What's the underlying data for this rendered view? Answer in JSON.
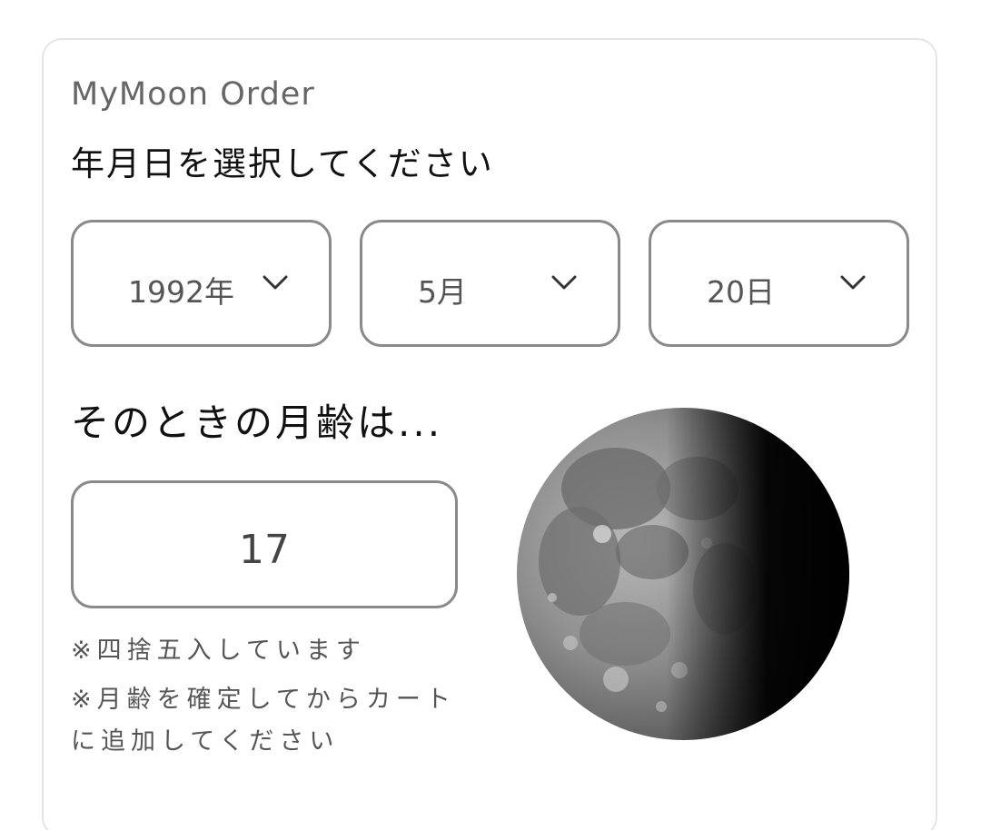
{
  "brand": "MyMoon Order",
  "prompt": "年月日を選択してください",
  "selectors": {
    "year": {
      "value": "1992年",
      "icon": "chevron-down-icon"
    },
    "month": {
      "value": "5月",
      "icon": "chevron-down-icon"
    },
    "day": {
      "value": "20日",
      "icon": "chevron-down-icon"
    }
  },
  "result": {
    "heading": "そのときの月齢は...",
    "moon_age": "17"
  },
  "notes": {
    "rounding": "※四捨五入しています",
    "add_to_cart": "※月齢を確定してからカートに追加してください"
  },
  "colors": {
    "border": "#8a8a8a",
    "card_border": "#e4e4e4",
    "text": "#222222",
    "muted_text": "#555555"
  }
}
